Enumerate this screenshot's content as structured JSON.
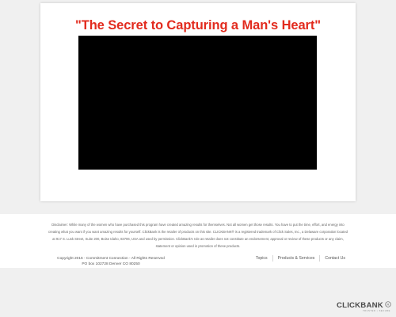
{
  "main": {
    "headline": "\"The Secret to Capturing a Man's Heart\""
  },
  "footer": {
    "disclaimer": "Disclaimer: While many of the women who have purchased this program have created amazing results for themselves. Not all women get those results. You have to put the time, effort, and energy into creating what you want if you want amazing results for yourself. ClickBank is the retailer of products on this site. CLICKBANK® is a registered trademark of Click Sales, Inc., a Delaware corporation located at 917 S. Lusk Street, Suite 200, Boise Idaho, 83706, USA and used by permission. ClickBank's role as retailer does not constitute an endorsement, approval or review of these products or any claim, statement or opinion used in promotion of these products.",
    "copyright_line1": "Copyright 2016 - Commitment Connection - All Rights Reserved",
    "copyright_line2": "PO box 102728 Denver CO 80250",
    "nav": [
      {
        "label": "Topics"
      },
      {
        "label": "Products & Services"
      },
      {
        "label": "Contact Us"
      }
    ]
  },
  "badge": {
    "brand": "CLICKBANK",
    "tagline": "TRUSTED • SECURE"
  },
  "colors": {
    "headline": "#e22b1e",
    "video_background": "#000000",
    "page_background": "#f0f0f0"
  }
}
